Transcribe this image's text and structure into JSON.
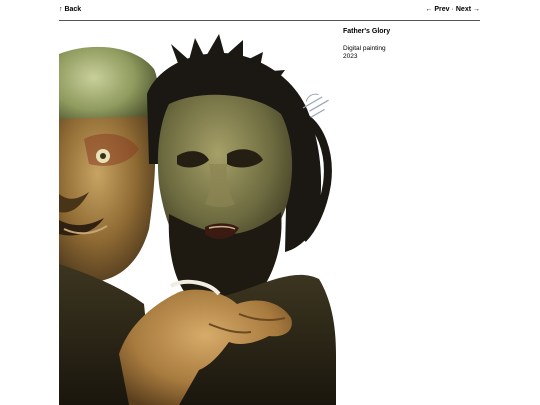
{
  "nav": {
    "back_label": "↑ Back",
    "prev_label": "← Prev",
    "separator": "·",
    "next_label": "Next →"
  },
  "artwork": {
    "title": "Father's Glory",
    "medium": "Digital painting",
    "year": "2023",
    "signature": "Father's Glory"
  },
  "colors": {
    "background": "#ffffff",
    "rule": "#555555",
    "text": "#000000"
  }
}
